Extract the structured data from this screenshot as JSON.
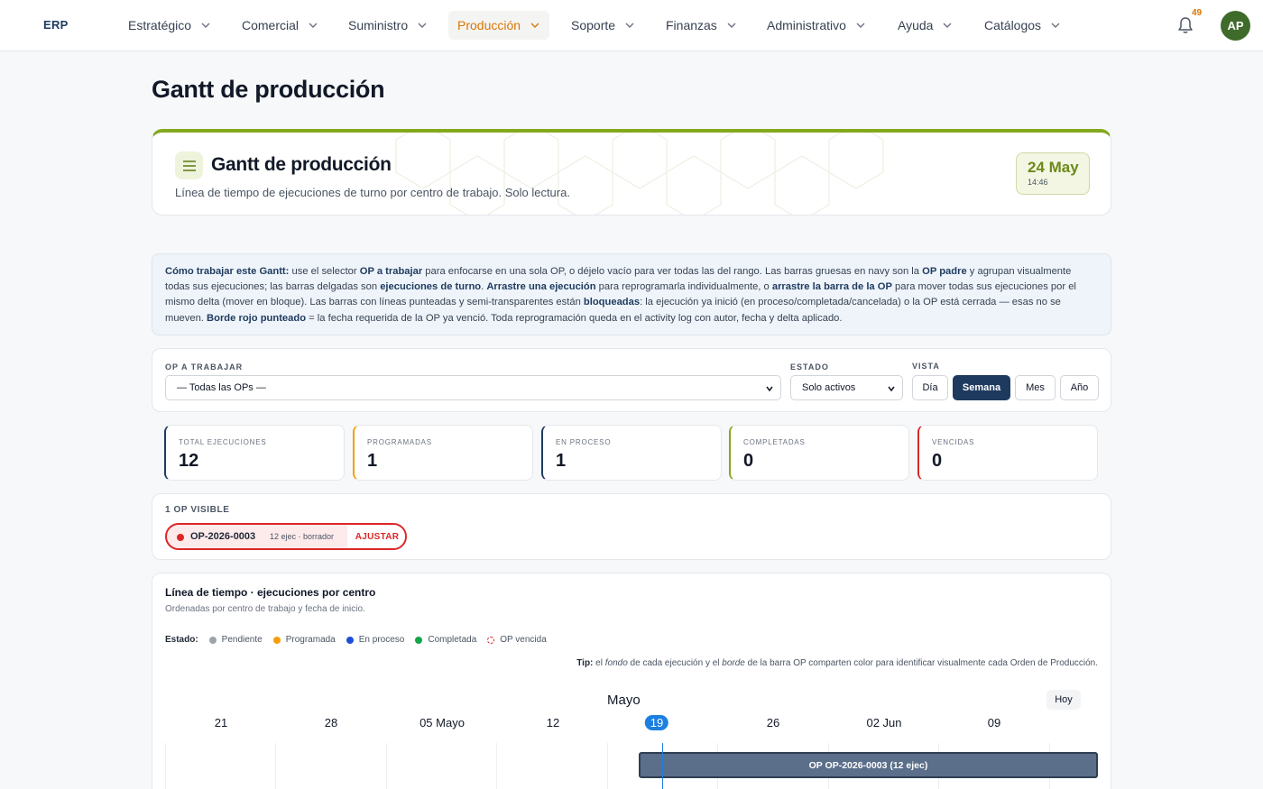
{
  "nav": {
    "brand": "ERP",
    "items": [
      {
        "label": "Estratégico"
      },
      {
        "label": "Comercial"
      },
      {
        "label": "Suministro"
      },
      {
        "label": "Producción"
      },
      {
        "label": "Soporte"
      },
      {
        "label": "Finanzas"
      },
      {
        "label": "Administrativo"
      },
      {
        "label": "Ayuda"
      },
      {
        "label": "Catálogos"
      }
    ],
    "active": "Producción",
    "notifications": "49",
    "avatar": "AP"
  },
  "page": {
    "title": "Gantt de producción"
  },
  "hero": {
    "title": "Gantt de producción",
    "subtitle": "Línea de tiempo de ejecuciones de turno por centro de trabajo. Solo lectura.",
    "date": "24 May",
    "time": "14:46"
  },
  "help": {
    "p1": "Cómo trabajar este Gantt:",
    "p2": " use el selector ",
    "p3": "OP a trabajar",
    "p4": " para enfocarse en una sola OP, o déjelo vacío para ver todas las del rango. Las barras gruesas en navy son la ",
    "p5": "OP padre",
    "p6": " y agrupan visualmente todas sus ejecuciones; las barras delgadas son ",
    "p7": "ejecuciones de turno",
    "p8": ". ",
    "p9": "Arrastre una ejecución",
    "p10": " para reprogramarla individualmente, o ",
    "p11": "arrastre la barra de la OP",
    "p12": " para mover todas sus ejecuciones por el mismo delta (mover en bloque). Las barras con líneas punteadas y semi-transparentes están ",
    "p13": "bloqueadas",
    "p14": ": la ejecución ya inició (en proceso/completada/cancelada) o la OP está cerrada — esas no se mueven. ",
    "p15": "Borde rojo punteado",
    "p16": " = la fecha requerida de la OP ya venció. Toda reprogramación queda en el activity log con autor, fecha y delta aplicado."
  },
  "filters": {
    "op_label": "OP A TRABAJAR",
    "op_value": "— Todas las OPs —",
    "estado_label": "ESTADO",
    "estado_value": "Solo activos",
    "vista_label": "VISTA",
    "views": [
      "Día",
      "Semana",
      "Mes",
      "Año"
    ],
    "active_view": "Semana"
  },
  "stats": [
    {
      "label": "TOTAL EJECUCIONES",
      "value": "12",
      "accent": "#1e3a5f"
    },
    {
      "label": "PROGRAMADAS",
      "value": "1",
      "accent": "#f59e0b"
    },
    {
      "label": "EN PROCESO",
      "value": "1",
      "accent": "#1e3a5f"
    },
    {
      "label": "COMPLETADAS",
      "value": "0",
      "accent": "#84a81f"
    },
    {
      "label": "VENCIDAS",
      "value": "0",
      "accent": "#dc2626"
    }
  ],
  "ops": {
    "header": "1 OP VISIBLE",
    "chip": {
      "code": "OP-2026-0003",
      "meta": "12 ejec · borrador",
      "action": "AJUSTAR"
    }
  },
  "timeline": {
    "title": "Línea de tiempo · ejecuciones por centro",
    "subtitle": "Ordenadas por centro de trabajo y fecha de inicio.",
    "legend_label": "Estado:",
    "legend": [
      {
        "label": "Pendiente",
        "color": "#9ca3af"
      },
      {
        "label": "Programada",
        "color": "#f59e0b"
      },
      {
        "label": "En proceso",
        "color": "#1d4ed8"
      },
      {
        "label": "Completada",
        "color": "#16a34a"
      },
      {
        "label": "OP vencida",
        "color": "#dc2626"
      }
    ],
    "tip_label": "Tip:",
    "tip_1": " el ",
    "tip_2": "fondo",
    "tip_3": " de cada ejecución y el ",
    "tip_4": "borde",
    "tip_5": " de la barra OP comparten color para identificar visualmente cada Orden de Producción.",
    "month": "Mayo",
    "today_btn": "Hoy",
    "ticks": [
      "21",
      "28",
      "05 Mayo",
      "12",
      "19",
      "26",
      "02 Jun",
      "09"
    ],
    "current_tick": "19",
    "op_bar_label": "OP OP-2026-0003 (12 ejec)"
  }
}
